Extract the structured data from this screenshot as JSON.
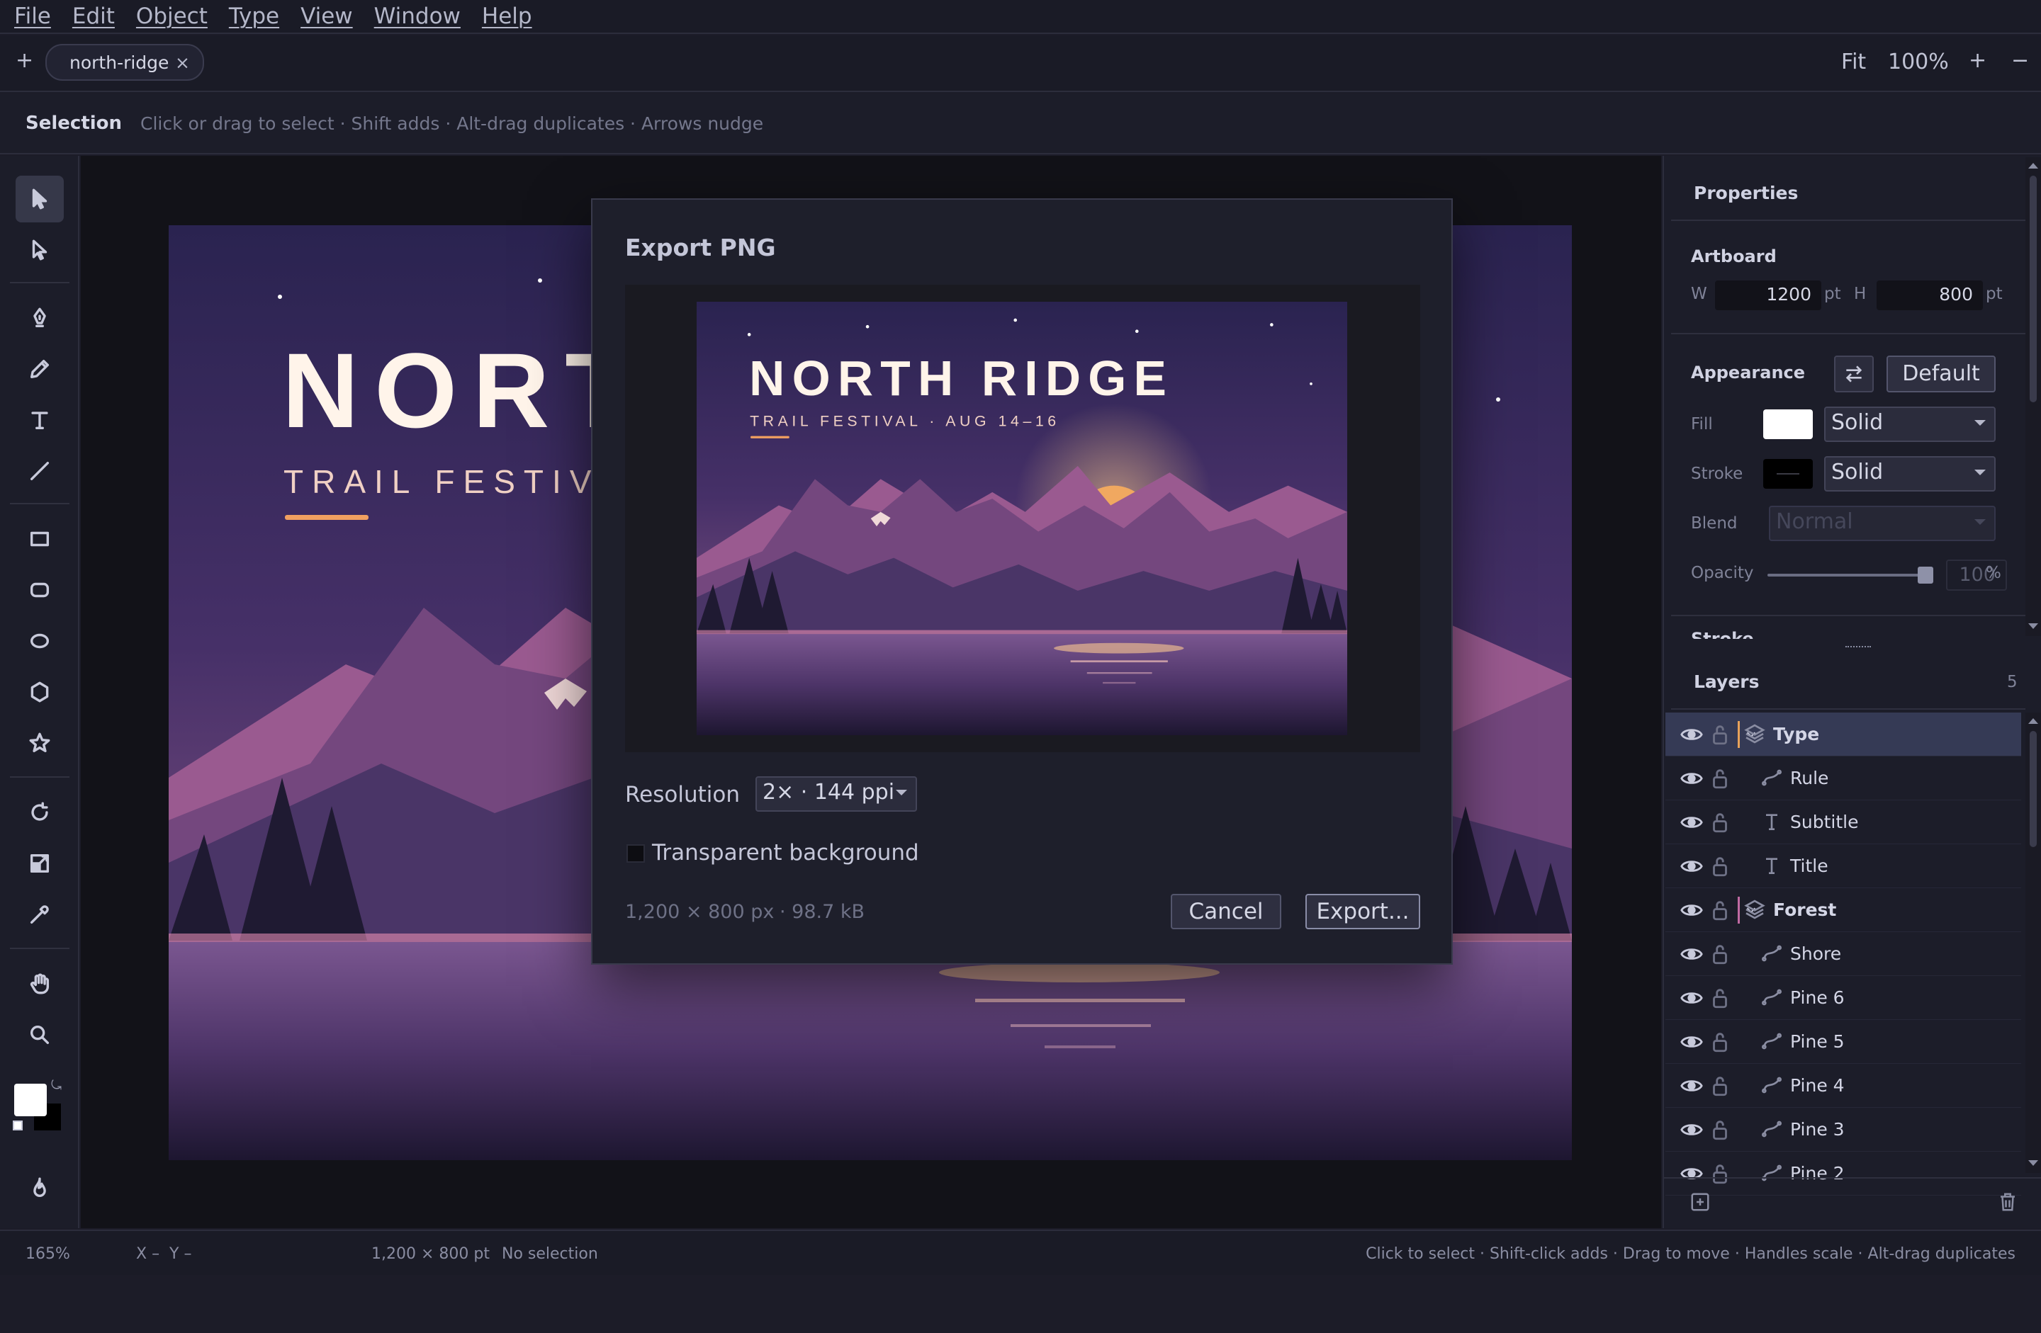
{
  "menu": [
    "File",
    "Edit",
    "Object",
    "Type",
    "View",
    "Window",
    "Help"
  ],
  "tabs": {
    "add_label": "+",
    "active_tab": "north-ridge",
    "close_label": "×"
  },
  "zoom": {
    "fit_label": "Fit",
    "level": "100%",
    "zoom_in": "+",
    "zoom_out": "−"
  },
  "options_bar": {
    "tool_name": "Selection",
    "hint": "Click or drag to select · Shift adds · Alt-drag duplicates · Arrows nudge"
  },
  "artwork": {
    "title": "NORTH RIDGE",
    "subtitle": "TRAIL FESTIVAL · AUG 14–16",
    "visible_title": "NORT",
    "visible_subtitle": "TRAIL FESTIVAL"
  },
  "dialog": {
    "title": "Export PNG",
    "resolution_label": "Resolution",
    "resolution_value": "2× · 144 ppi",
    "transparent_label": "Transparent background",
    "transparent_checked": false,
    "dimensions": "1,200 × 800 px",
    "filesize": "· 98.7 kB",
    "cancel_label": "Cancel",
    "export_label": "Export..."
  },
  "properties": {
    "title": "Properties",
    "artboard_label": "Artboard",
    "w_label": "W",
    "w_value": "1200",
    "w_unit": "pt",
    "h_label": "H",
    "h_value": "800",
    "h_unit": "pt",
    "appearance_label": "Appearance",
    "default_label": "Default",
    "fill_label": "Fill",
    "fill_type": "Solid",
    "fill_color": "#ffffff",
    "stroke_label": "Stroke",
    "stroke_type": "Solid",
    "stroke_color": "#000000",
    "blend_label": "Blend",
    "blend_value": "Normal",
    "opacity_label": "Opacity",
    "opacity_value": "100",
    "opacity_unit": "%",
    "stroke_section_label": "Stroke"
  },
  "layers": {
    "title": "Layers",
    "count": "5",
    "items": [
      {
        "name": "Type",
        "kind": "group",
        "selected": true,
        "color": "#e8a25a"
      },
      {
        "name": "Rule",
        "kind": "path"
      },
      {
        "name": "Subtitle",
        "kind": "text"
      },
      {
        "name": "Title",
        "kind": "text"
      },
      {
        "name": "Forest",
        "kind": "group",
        "color": "#c06aa2"
      },
      {
        "name": "Shore",
        "kind": "path"
      },
      {
        "name": "Pine 6",
        "kind": "path"
      },
      {
        "name": "Pine 5",
        "kind": "path"
      },
      {
        "name": "Pine 4",
        "kind": "path"
      },
      {
        "name": "Pine 3",
        "kind": "path"
      },
      {
        "name": "Pine 2",
        "kind": "path"
      }
    ]
  },
  "status": {
    "zoom": "165%",
    "coords": "X –  Y –",
    "doc_size": "1,200 × 800 pt",
    "selection": "No selection",
    "hint": "Click to select · Shift-click adds · Drag to move · Handles scale · Alt-drag duplicates"
  }
}
